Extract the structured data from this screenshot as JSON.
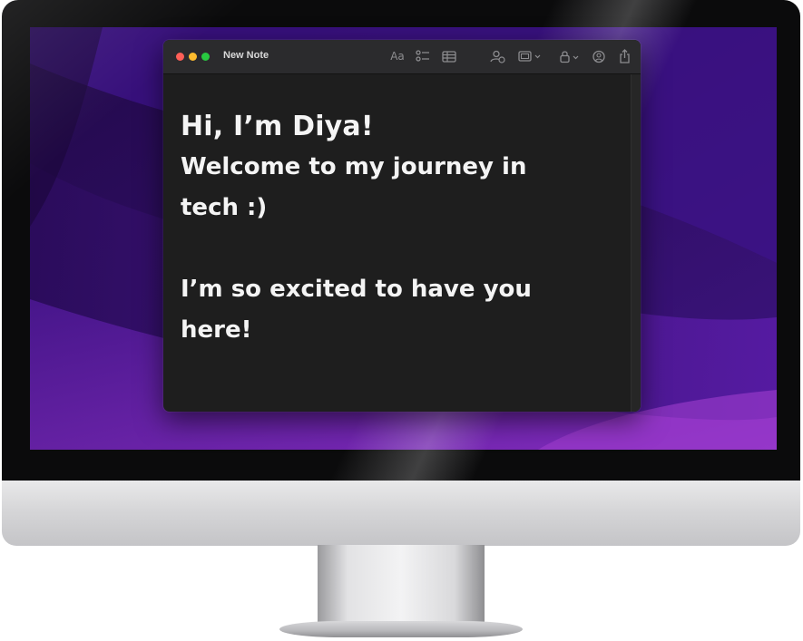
{
  "window": {
    "title": "New Note"
  },
  "toolbar": {
    "icons": [
      "format-text-icon",
      "checklist-icon",
      "table-icon",
      "collaborate-icon",
      "media-icon",
      "lock-icon",
      "share-link-icon",
      "share-icon"
    ],
    "format_label": "Aa"
  },
  "note": {
    "heading": "Hi, I’m Diya!",
    "line1": "Welcome to my journey in",
    "line2": "tech :)",
    "line3": "I’m so excited to have you",
    "line4": "here!"
  },
  "colors": {
    "close": "#ff5f57",
    "minimize": "#febc2e",
    "maximize": "#28c840",
    "note_background": "#1e1e1e",
    "wallpaper": "#3b1475"
  }
}
